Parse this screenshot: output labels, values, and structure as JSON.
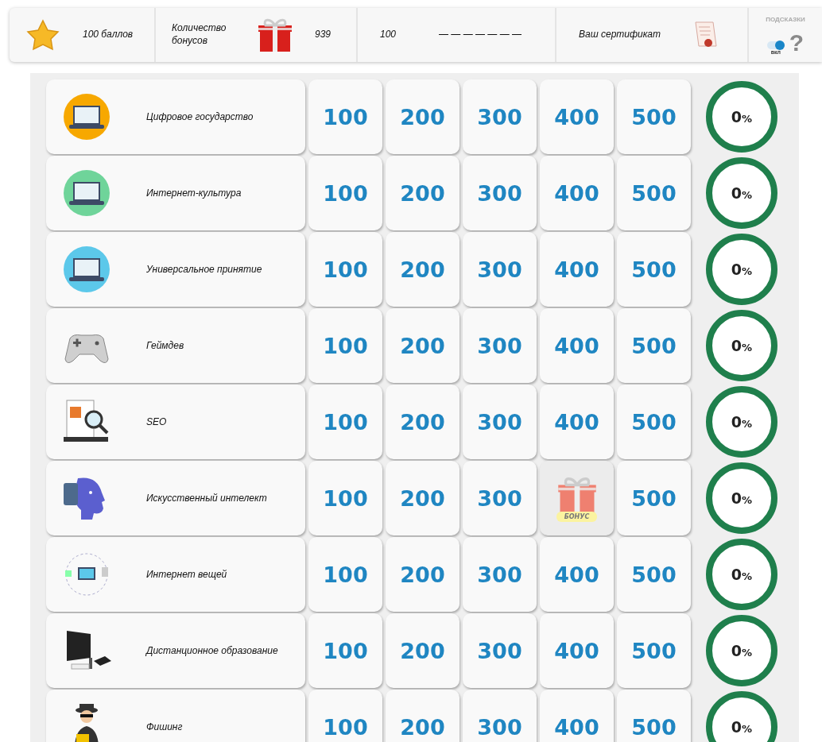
{
  "top_bar": {
    "score": "100 баллов",
    "bonus_label": "Количество бонусов",
    "bonus_count": "939",
    "points": "100",
    "progress_dashes": "— — — — — — —",
    "certificate": "Ваш сертификат",
    "hints": {
      "title": "ПОДСКАЗКИ",
      "toggle_label": "вкл",
      "on": true,
      "help": "?"
    }
  },
  "categories": [
    {
      "name": "Цифровое государство",
      "kind": "laptop",
      "progress": {
        "value": "0",
        "unit": "%"
      },
      "cells": [
        {
          "kind": "points",
          "label": "100"
        },
        {
          "kind": "points",
          "label": "200"
        },
        {
          "kind": "points",
          "label": "300"
        },
        {
          "kind": "points",
          "label": "400"
        },
        {
          "kind": "points",
          "label": "500"
        }
      ]
    },
    {
      "name": "Интернет-культура",
      "kind": "laptop",
      "progress": {
        "value": "0",
        "unit": "%"
      },
      "cells": [
        {
          "kind": "points",
          "label": "100"
        },
        {
          "kind": "points",
          "label": "200"
        },
        {
          "kind": "points",
          "label": "300"
        },
        {
          "kind": "points",
          "label": "400"
        },
        {
          "kind": "points",
          "label": "500"
        }
      ]
    },
    {
      "name": "Универсальное принятие",
      "kind": "laptop",
      "progress": {
        "value": "0",
        "unit": "%"
      },
      "cells": [
        {
          "kind": "points",
          "label": "100"
        },
        {
          "kind": "points",
          "label": "200"
        },
        {
          "kind": "points",
          "label": "300"
        },
        {
          "kind": "points",
          "label": "400"
        },
        {
          "kind": "points",
          "label": "500"
        }
      ]
    },
    {
      "name": "Геймдев",
      "kind": "gamepad",
      "progress": {
        "value": "0",
        "unit": "%"
      },
      "cells": [
        {
          "kind": "points",
          "label": "100"
        },
        {
          "kind": "points",
          "label": "200"
        },
        {
          "kind": "points",
          "label": "300"
        },
        {
          "kind": "points",
          "label": "400"
        },
        {
          "kind": "points",
          "label": "500"
        }
      ]
    },
    {
      "name": "SEO",
      "kind": "magnifier",
      "progress": {
        "value": "0",
        "unit": "%"
      },
      "cells": [
        {
          "kind": "points",
          "label": "100"
        },
        {
          "kind": "points",
          "label": "200"
        },
        {
          "kind": "points",
          "label": "300"
        },
        {
          "kind": "points",
          "label": "400"
        },
        {
          "kind": "points",
          "label": "500"
        }
      ]
    },
    {
      "name": "Искусственный интелект",
      "kind": "robot",
      "progress": {
        "value": "0",
        "unit": "%"
      },
      "cells": [
        {
          "kind": "points",
          "label": "100"
        },
        {
          "kind": "points",
          "label": "200"
        },
        {
          "kind": "points",
          "label": "300"
        },
        {
          "kind": "bonus",
          "label": "БОНУС"
        },
        {
          "kind": "points",
          "label": "500"
        }
      ]
    },
    {
      "name": "Интернет вещей",
      "kind": "network",
      "progress": {
        "value": "0",
        "unit": "%"
      },
      "cells": [
        {
          "kind": "points",
          "label": "100"
        },
        {
          "kind": "points",
          "label": "200"
        },
        {
          "kind": "points",
          "label": "300"
        },
        {
          "kind": "points",
          "label": "400"
        },
        {
          "kind": "points",
          "label": "500"
        }
      ]
    },
    {
      "name": "Дистанционное образование",
      "kind": "monitor",
      "progress": {
        "value": "0",
        "unit": "%"
      },
      "cells": [
        {
          "kind": "points",
          "label": "100"
        },
        {
          "kind": "points",
          "label": "200"
        },
        {
          "kind": "points",
          "label": "300"
        },
        {
          "kind": "points",
          "label": "400"
        },
        {
          "kind": "points",
          "label": "500"
        }
      ]
    },
    {
      "name": "Фишинг",
      "kind": "spy",
      "progress": {
        "value": "0",
        "unit": "%"
      },
      "cells": [
        {
          "kind": "points",
          "label": "100"
        },
        {
          "kind": "points",
          "label": "200"
        },
        {
          "kind": "points",
          "label": "300"
        },
        {
          "kind": "points",
          "label": "400"
        },
        {
          "kind": "points",
          "label": "500"
        }
      ]
    }
  ]
}
